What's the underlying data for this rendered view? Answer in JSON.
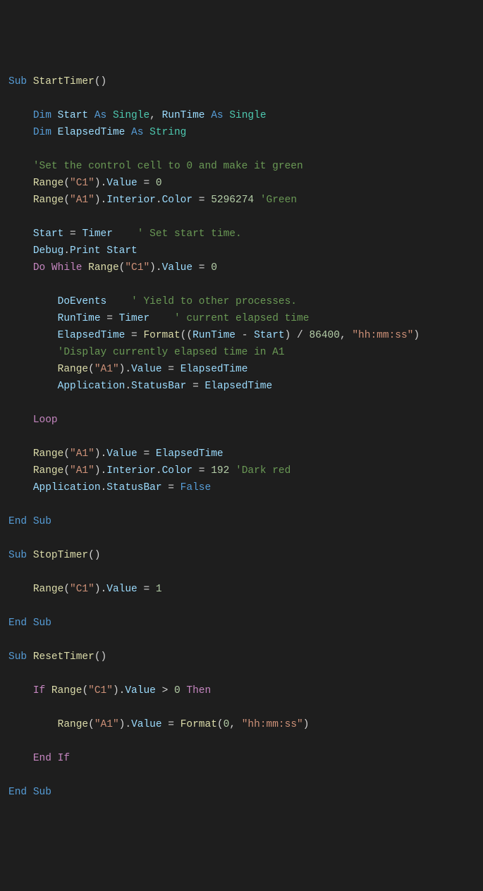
{
  "code": {
    "t_sub": "Sub",
    "t_end": "End",
    "t_dim": "Dim",
    "t_as": "As",
    "t_do": "Do",
    "t_while": "While",
    "t_loop": "Loop",
    "t_if": "If",
    "t_then": "Then",
    "t_endif_end": "End",
    "t_endif_if": "If",
    "t_single": "Single",
    "t_string": "String",
    "t_false": "False",
    "fn_start": "StartTimer",
    "fn_stop": "StopTimer",
    "fn_reset": "ResetTimer",
    "fn_range": "Range",
    "fn_format": "Format",
    "v_start": "Start",
    "v_runtime": "RunTime",
    "v_elapsed": "ElapsedTime",
    "v_timer": "Timer",
    "v_debug": "Debug",
    "v_print": "Print",
    "v_doevents": "DoEvents",
    "v_app": "Application",
    "p_value": "Value",
    "p_interior": "Interior",
    "p_color": "Color",
    "p_statusbar": "StatusBar",
    "s_c1": "\"C1\"",
    "s_a1": "\"A1\"",
    "s_hms": "\"hh:mm:ss\"",
    "n_0": "0",
    "n_1": "1",
    "n_192": "192",
    "n_5296274": "5296274",
    "n_86400": "86400",
    "c_setcontrol": "'Set the control cell to 0 and make it green",
    "c_green": "'Green",
    "c_setstart": "' Set start time.",
    "c_yield": "' Yield to other processes.",
    "c_curelapsed": "' current elapsed time",
    "c_display": "'Display currently elapsed time in A1",
    "c_darkred": "'Dark red",
    "op_eq": " = ",
    "op_gt": " > ",
    "op_minus": " - ",
    "op_div": " / ",
    "comma_sp": ", ",
    "paren_open": "(",
    "paren_close": ")",
    "paren_empty": "()",
    "dot": "."
  }
}
